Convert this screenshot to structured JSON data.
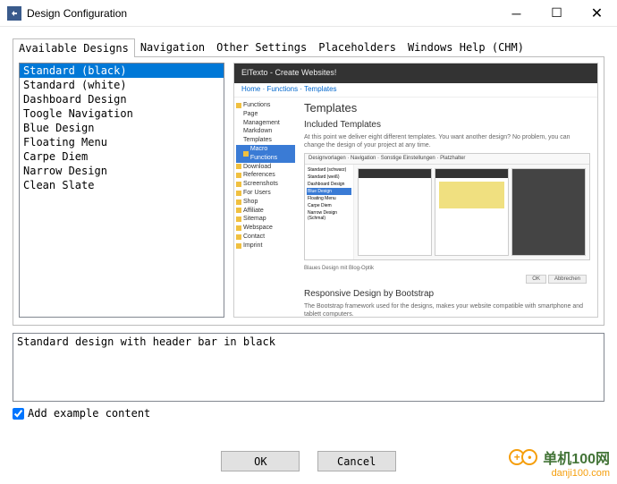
{
  "window": {
    "title": "Design Configuration"
  },
  "tabs": {
    "available": "Available Designs",
    "navigation": "Navigation",
    "other": "Other Settings",
    "placeholders": "Placeholders",
    "help": "Windows Help (CHM)"
  },
  "designs": [
    "Standard (black)",
    "Standard (white)",
    "Dashboard Design",
    "Toogle Navigation",
    "Blue Design",
    "Floating Menu",
    "Carpe Diem",
    "Narrow Design",
    "Clean Slate"
  ],
  "preview": {
    "header": "ElTexto - Create Websites!",
    "crumbs": "Home · Functions · Templates",
    "sidebar": [
      "Functions",
      "Page Management",
      "Markdown",
      "Templates",
      "Macro Functions",
      "Download",
      "References",
      "Screenshots",
      "For Users",
      "Shop",
      "Affiliate",
      "Sitemap",
      "Webspace",
      "Contact",
      "Imprint"
    ],
    "h1": "Templates",
    "h2": "Included Templates",
    "p1": "At this point we deliver eight different templates. You want another design? No problem, you can change the design of your project at any time.",
    "mocktabs": "Designvorlagen · Navigation · Sonstige Einstellungen · Platzhalter",
    "mocklist": [
      "Standard (schwarz)",
      "Standard (weiß)",
      "Dashboard Design",
      "Blue Design",
      "Floating Menu",
      "Carpe Diem",
      "Narrow Design (Schmal)"
    ],
    "mockcap": "Blaues Design mit Blog-Optik",
    "ok": "OK",
    "cancel": "Abbrechen",
    "h3": "Responsive Design by Bootstrap",
    "p2": "The Bootstrap framework used for the designs, makes your website compatible with smartphone and tablett computers."
  },
  "description": "Standard design with header bar in black",
  "checkbox": {
    "label": "Add example content",
    "checked": true
  },
  "buttons": {
    "ok": "OK",
    "cancel": "Cancel"
  },
  "watermark": {
    "text": "单机100网",
    "url": "danji100.com"
  }
}
